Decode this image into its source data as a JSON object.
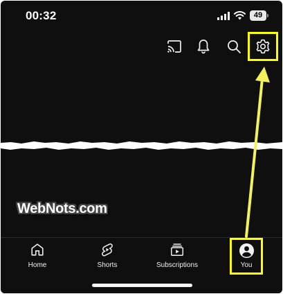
{
  "status_bar": {
    "time": "00:32",
    "battery_level": "49",
    "icons": [
      "signal-icon",
      "wifi-icon",
      "battery-icon"
    ]
  },
  "top_bar": {
    "icons": [
      "cast-icon",
      "bell-icon",
      "search-icon",
      "gear-icon"
    ]
  },
  "watermark": "WebNots.com",
  "bottom_nav": {
    "items": [
      {
        "label": "Home",
        "icon": "home-icon"
      },
      {
        "label": "Shorts",
        "icon": "shorts-icon"
      },
      {
        "label": "Subscriptions",
        "icon": "subscriptions-icon"
      },
      {
        "label": "You",
        "icon": "account-circle-icon"
      }
    ]
  },
  "colors": {
    "background": "#0f0f0f",
    "text": "#f1f1f1",
    "highlight": "#ffff00"
  }
}
